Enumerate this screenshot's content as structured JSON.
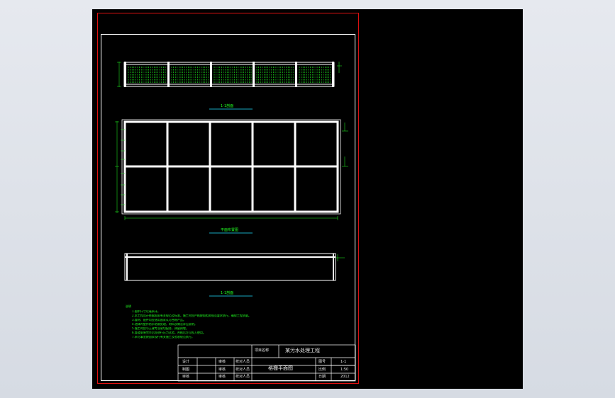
{
  "drawing": {
    "section_titles": [
      "1-1剖面",
      "平面布置图",
      "1-1剖面"
    ],
    "notes": {
      "heading": "说明",
      "lines": [
        "1.图中尺寸以毫米计。",
        "2.本工程设计依据国家有关规范及标准，施工时应严格按照相关规范要求执行，确保工程质量。",
        "3.管材、配件均应选用国家认可合格产品。",
        "4.池体内壁作防水防腐处理，材料及做法详见说明。",
        "5.施工时应与土建专业密切配合，预留预埋。",
        "6.管道安装完毕后应进行压力试验，合格后方可投入使用。",
        "7.未尽事宜按国家现行有关施工及验收规范执行。"
      ]
    },
    "title_block": {
      "project_label": "项目名称",
      "project_name": "某污水处理工程",
      "drawing_name": "格栅平面图",
      "rows": [
        {
          "role": "设计",
          "sign": "审核",
          "name": "校对人员"
        },
        {
          "role": "制图",
          "sign": "审核",
          "name": "校对人员"
        },
        {
          "role": "审核",
          "sign": "审核",
          "name": "校对人员"
        }
      ],
      "meta": [
        {
          "key": "图号",
          "value": "1-1"
        },
        {
          "key": "比例",
          "value": "1:50"
        },
        {
          "key": "日期",
          "value": "2012"
        }
      ]
    }
  },
  "colors": {
    "background": "#000000",
    "border_red": "#e01010",
    "line_white": "#ffffff",
    "dimension_green": "#22ff22",
    "title_cyan": "#22e0ff"
  }
}
